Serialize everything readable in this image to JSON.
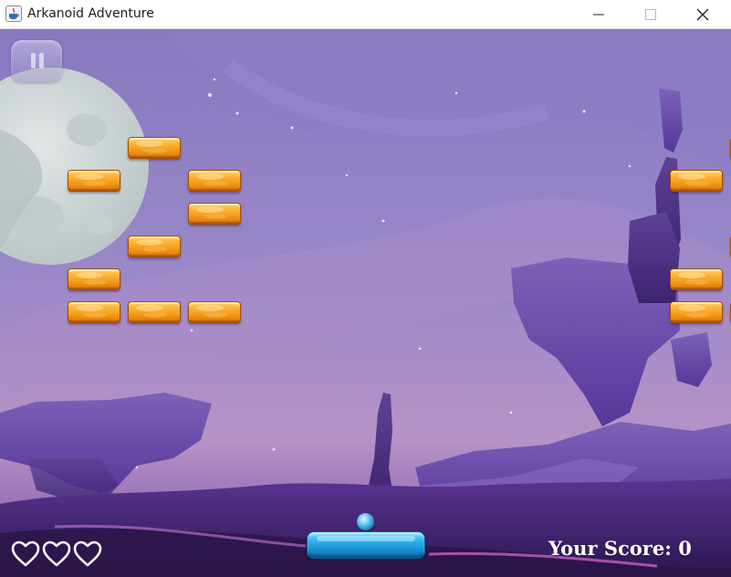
{
  "window": {
    "title": "Arkanoid Adventure",
    "icon": "java-cup-icon",
    "controls": [
      "minimize-icon",
      "maximize-icon",
      "close-icon"
    ]
  },
  "game": {
    "pause_icon": "pause-icon",
    "lives": 3,
    "life_icon": "heart-outline-icon",
    "score_text": "Your Score: 0",
    "colors": {
      "brick": "#f5a11f",
      "paddle": "#1e9be0",
      "ball": "#3aa8e6",
      "sky": "#8f7fc3",
      "hud_text": "#ffffff"
    },
    "bricks": [
      {
        "row": 0,
        "col": 2
      },
      {
        "row": 0,
        "col": 12
      },
      {
        "row": 1,
        "col": 1
      },
      {
        "row": 1,
        "col": 3
      },
      {
        "row": 1,
        "col": 11
      },
      {
        "row": 1,
        "col": 13
      },
      {
        "row": 2,
        "col": 3
      },
      {
        "row": 2,
        "col": 13
      },
      {
        "row": 3,
        "col": 2
      },
      {
        "row": 3,
        "col": 12
      },
      {
        "row": 4,
        "col": 1
      },
      {
        "row": 4,
        "col": 11
      },
      {
        "row": 5,
        "col": 1
      },
      {
        "row": 5,
        "col": 2
      },
      {
        "row": 5,
        "col": 3
      },
      {
        "row": 5,
        "col": 11
      },
      {
        "row": 5,
        "col": 12
      },
      {
        "row": 5,
        "col": 13
      }
    ]
  }
}
